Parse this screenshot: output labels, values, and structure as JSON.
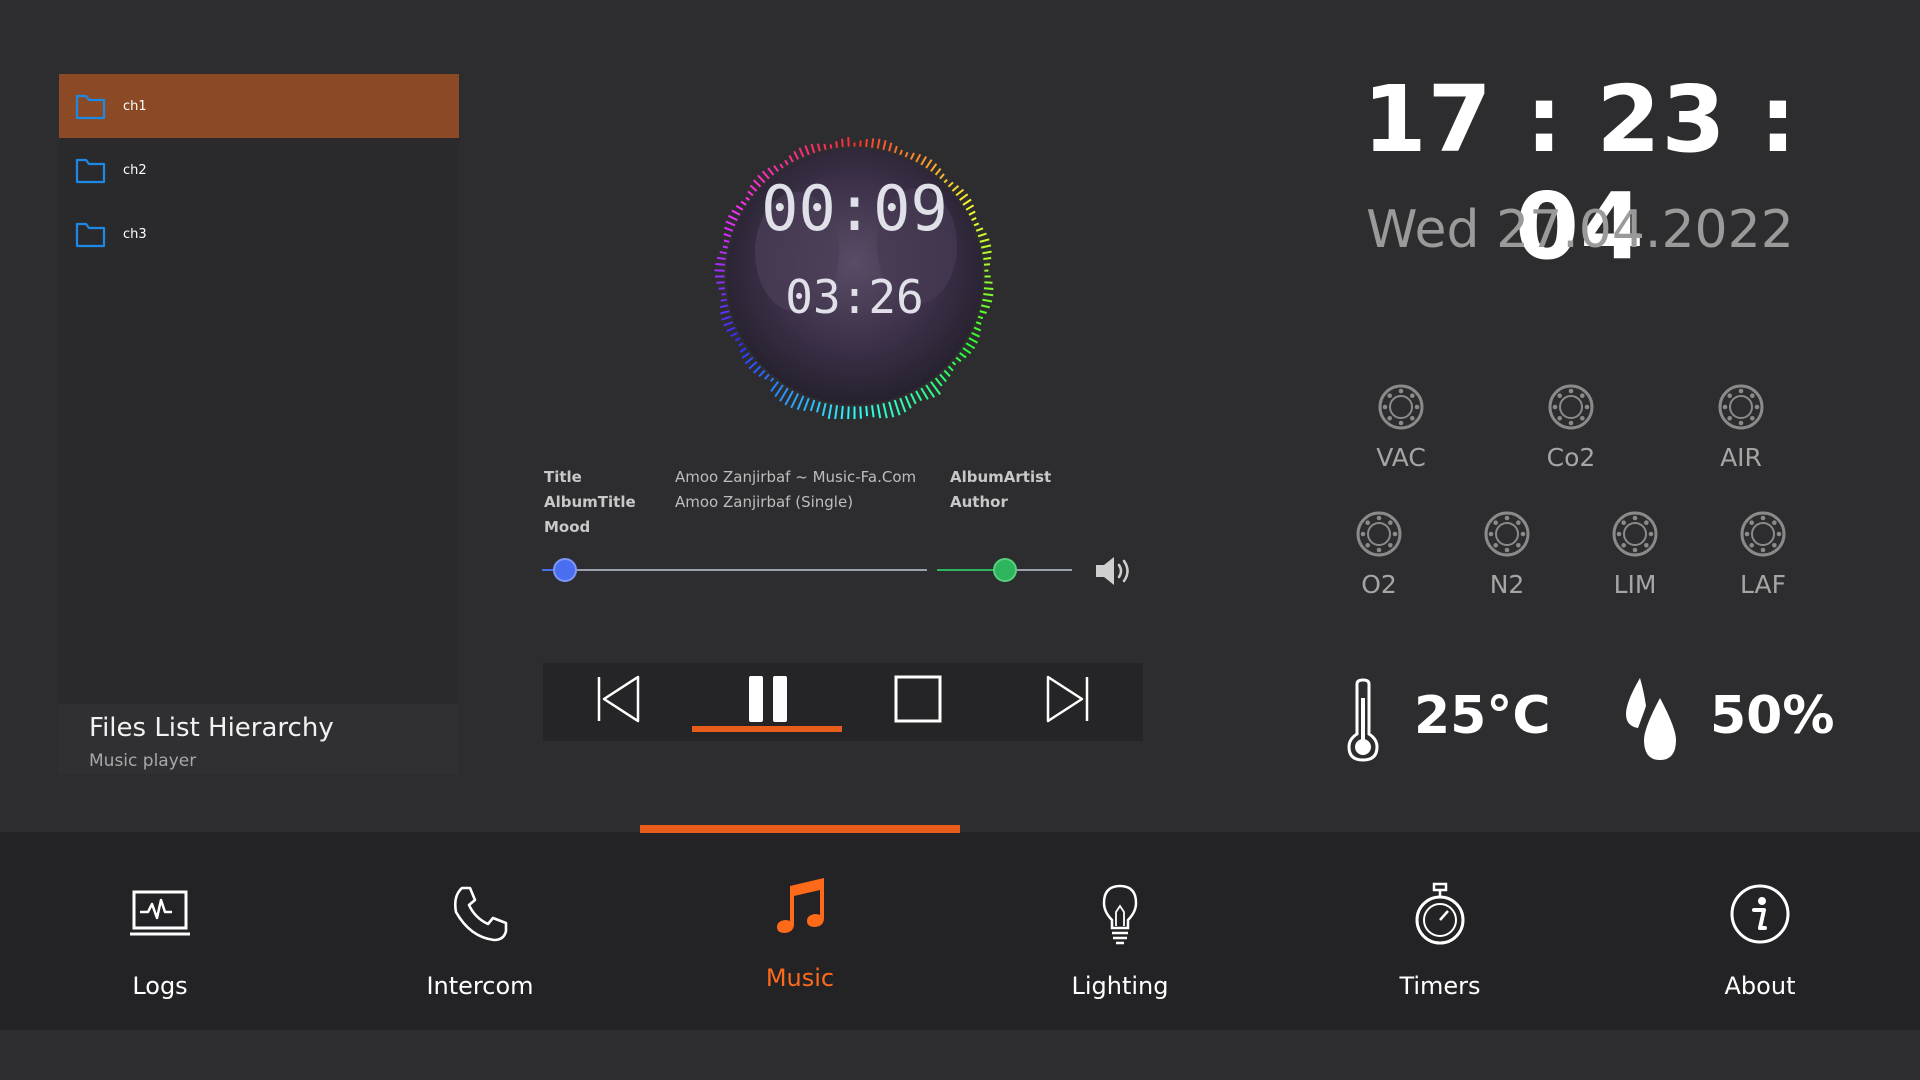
{
  "files": {
    "items": [
      {
        "label": "ch1",
        "icon": "folder-icon",
        "selected": true
      },
      {
        "label": "ch2",
        "icon": "folder-icon",
        "selected": false
      },
      {
        "label": "ch3",
        "icon": "folder-icon",
        "selected": false
      }
    ],
    "title": "Files List Hierarchy",
    "subtitle": "Music player"
  },
  "player": {
    "elapsed": "00:09",
    "duration": "03:26",
    "metadata": [
      {
        "key": "Title",
        "value": "Amoo Zanjirbaf ~ Music-Fa.Com"
      },
      {
        "key": "AlbumTitle",
        "value": "Amoo Zanjirbaf (Single)"
      },
      {
        "key": "Mood",
        "value": ""
      }
    ],
    "metadata_right": [
      {
        "key": "AlbumArtist"
      },
      {
        "key": "Author"
      }
    ],
    "seek_fraction": 0.06,
    "volume_fraction": 0.5,
    "controls": [
      {
        "name": "previous-button",
        "icon": "skip-previous-icon"
      },
      {
        "name": "pause-button",
        "icon": "pause-icon"
      },
      {
        "name": "stop-button",
        "icon": "stop-icon"
      },
      {
        "name": "next-button",
        "icon": "skip-next-icon"
      }
    ],
    "active_control": 1,
    "accent": "#e85d1c",
    "seek_color": "#4a6ef0",
    "volume_color": "#2fb45e"
  },
  "clock": {
    "time": "17 : 23 : 04",
    "date": "Wed 27.04.2022"
  },
  "gases": {
    "row1": [
      "VAC",
      "Co2",
      "AIR"
    ],
    "row2": [
      "O2",
      "N2",
      "LIM",
      "LAF"
    ]
  },
  "climate": {
    "temperature": "25°C",
    "humidity": "50%"
  },
  "nav": {
    "items": [
      {
        "label": "Logs",
        "icon": "monitor-pulse-icon"
      },
      {
        "label": "Intercom",
        "icon": "phone-icon"
      },
      {
        "label": "Music",
        "icon": "music-note-icon",
        "active": true
      },
      {
        "label": "Lighting",
        "icon": "lightbulb-icon"
      },
      {
        "label": "Timers",
        "icon": "stopwatch-icon"
      },
      {
        "label": "About",
        "icon": "info-icon"
      }
    ],
    "active_color": "#ff6a1a"
  }
}
